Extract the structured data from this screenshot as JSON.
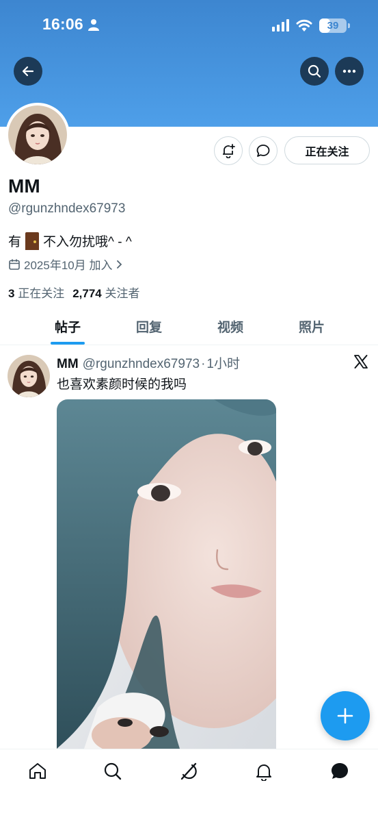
{
  "status_bar": {
    "time": "16:06",
    "battery": "39",
    "battery_level": 0.39,
    "icons": [
      "person-icon",
      "signal-icon",
      "wifi-icon",
      "battery-icon"
    ]
  },
  "header": {
    "back_icon": "arrow-left-icon",
    "search_icon": "search-icon",
    "more_icon": "more-icon"
  },
  "profile": {
    "display_name": "MM",
    "handle": "@rgunzhndex67973",
    "bio_prefix": "有",
    "bio_emoji_icon": "door-icon",
    "bio_suffix": "不入勿扰哦^ - ^",
    "joined": "2025年10月 加入",
    "following_count": "3",
    "following_label": "正在关注",
    "followers_count": "2,774",
    "followers_label": "关注者",
    "follow_button_label": "正在关注"
  },
  "tabs": [
    {
      "label": "帖子",
      "active": true
    },
    {
      "label": "回复",
      "active": false
    },
    {
      "label": "视频",
      "active": false
    },
    {
      "label": "照片",
      "active": false
    }
  ],
  "post": {
    "name": "MM",
    "handle": "@rgunzhndex67973",
    "separator": "·",
    "time": "1小时",
    "text": "也喜欢素颜时候的我吗"
  },
  "bottom_nav": [
    "home-icon",
    "search-icon",
    "grok-icon",
    "notifications-icon",
    "messages-icon"
  ],
  "colors": {
    "banner": "#4e9fe9",
    "accent": "#1d9bf0",
    "text": "#0f1419",
    "secondary_text": "#536471"
  }
}
